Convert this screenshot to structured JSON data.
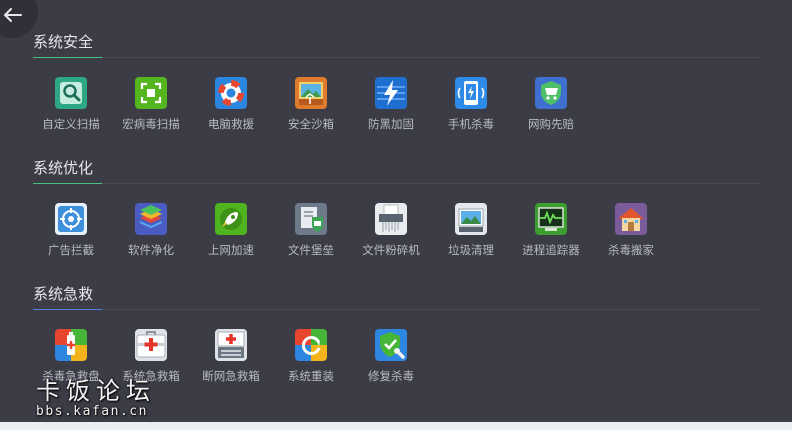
{
  "back_button": {
    "icon": "arrow-left-icon"
  },
  "sections": [
    {
      "title": "系统安全",
      "tools": [
        {
          "label": "自定义扫描",
          "icon": "magnifier-scan-icon"
        },
        {
          "label": "宏病毒扫描",
          "icon": "macro-scan-icon"
        },
        {
          "label": "电脑救援",
          "icon": "lifebuoy-icon"
        },
        {
          "label": "安全沙箱",
          "icon": "sandbox-icon"
        },
        {
          "label": "防黑加固",
          "icon": "lightning-shield-icon"
        },
        {
          "label": "手机杀毒",
          "icon": "phone-icon"
        },
        {
          "label": "网购先赔",
          "icon": "cart-shield-icon"
        }
      ]
    },
    {
      "title": "系统优化",
      "tools": [
        {
          "label": "广告拦截",
          "icon": "target-icon"
        },
        {
          "label": "软件净化",
          "icon": "layers-icon"
        },
        {
          "label": "上网加速",
          "icon": "rocket-icon"
        },
        {
          "label": "文件堡垒",
          "icon": "file-vault-icon"
        },
        {
          "label": "文件粉碎机",
          "icon": "shredder-icon"
        },
        {
          "label": "垃圾清理",
          "icon": "picture-clean-icon"
        },
        {
          "label": "进程追踪器",
          "icon": "pulse-monitor-icon"
        },
        {
          "label": "杀毒搬家",
          "icon": "house-icon"
        }
      ]
    },
    {
      "title": "系统急救",
      "tools": [
        {
          "label": "杀毒急救盘",
          "icon": "usb-rescue-icon"
        },
        {
          "label": "系统急救箱",
          "icon": "first-aid-kit-icon"
        },
        {
          "label": "断网急救箱",
          "icon": "network-aid-icon"
        },
        {
          "label": "系统重装",
          "icon": "reinstall-icon"
        },
        {
          "label": "修复杀毒",
          "icon": "repair-shield-icon"
        }
      ]
    }
  ],
  "watermark": {
    "title": "卡饭论坛",
    "url": "bbs.kafan.cn"
  }
}
